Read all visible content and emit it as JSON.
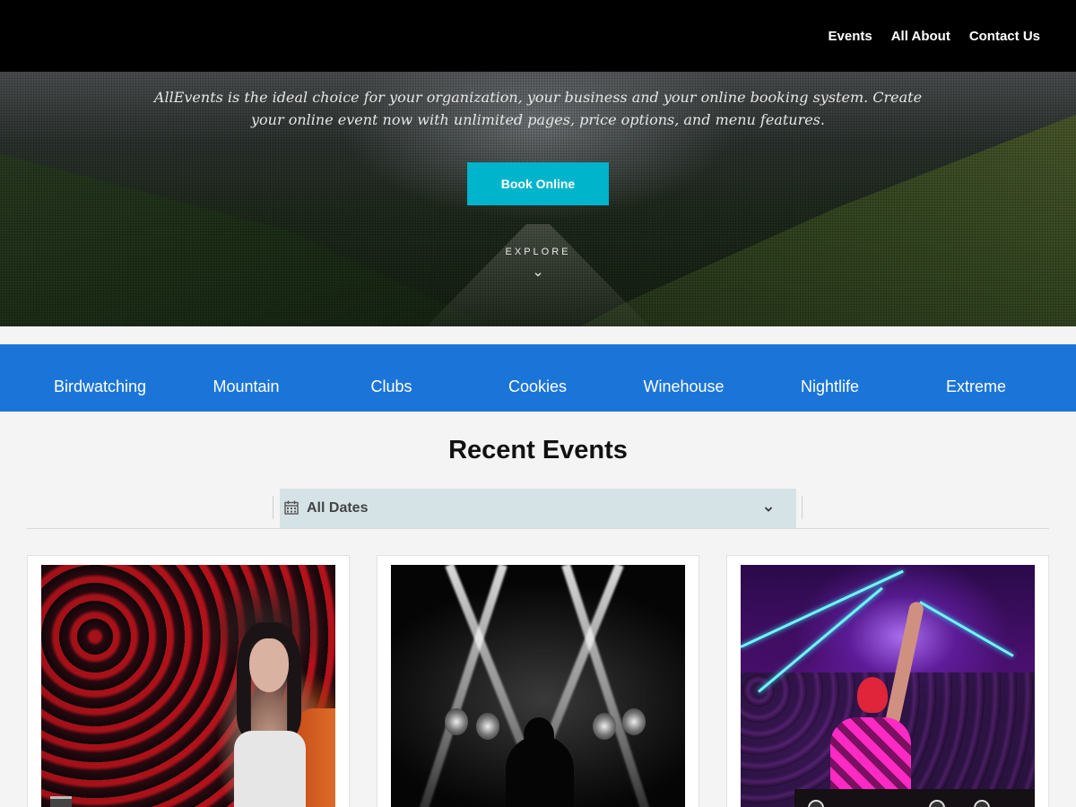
{
  "nav": {
    "items": [
      "Events",
      "All About",
      "Contact Us"
    ]
  },
  "hero": {
    "text": "AllEvents is the ideal choice for your organization, your business and your online booking system. Create your online event now with unlimited pages, price options, and menu features.",
    "book_button": "Book Online",
    "explore": "EXPLORE"
  },
  "categories": [
    "Birdwatching",
    "Mountain",
    "Clubs",
    "Cookies",
    "Winehouse",
    "Nightlife",
    "Extreme"
  ],
  "events": {
    "title": "Recent Events",
    "date_filter": "All Dates"
  },
  "colors": {
    "accent_button": "#00b4cc",
    "category_bar": "#1b75d8",
    "date_select_bg": "#d6e3e6",
    "header_bg": "#000000"
  },
  "icons": {
    "date_filter": "calendar-icon",
    "date_dropdown": "chevron-down-icon",
    "explore": "chevron-down-icon"
  }
}
